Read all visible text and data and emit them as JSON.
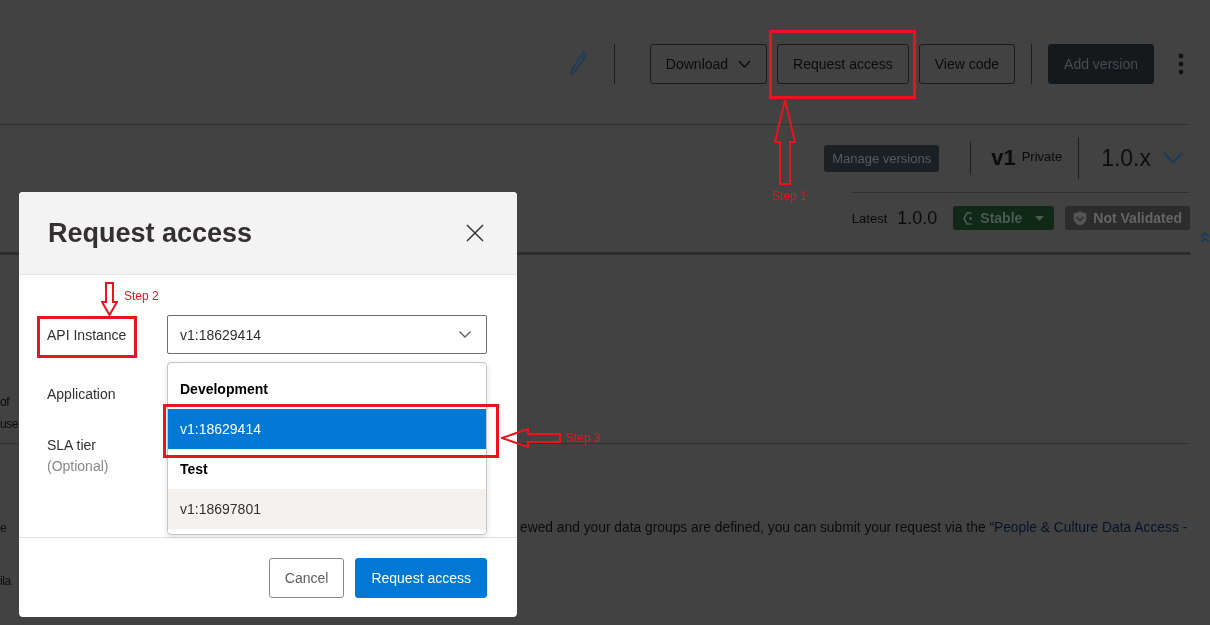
{
  "header": {
    "actions": [
      {
        "kind": "outline",
        "label": "Download",
        "menu": true
      },
      {
        "kind": "outline",
        "label": "Request access",
        "menu": false,
        "annotation": {
          "kind": "up_arrow",
          "label": "Step 1"
        }
      },
      {
        "kind": "outline",
        "label": "View code",
        "menu": false
      },
      {
        "kind": "primary",
        "label": "Add version",
        "menu": false
      }
    ]
  },
  "version_panel": {
    "manage_button": "Manage versions",
    "major_version": "v1",
    "visibility": "Private",
    "version_line": "1.0.x",
    "latest_label": "Latest",
    "latest_version": "1.0.0",
    "badges": [
      {
        "kind": "status",
        "label": "Stable",
        "menu": true
      },
      {
        "kind": "validation",
        "label": "Not Validated",
        "menu": false
      }
    ]
  },
  "content": {
    "paragraph_lines": [
      "of",
      "use"
    ],
    "sentence": {
      "left_fragment": "e",
      "text": "ewed and your data groups are defined, you can submit your request via the “",
      "link": "People & Culture Data Access -"
    },
    "trailing_fragment": "ila"
  },
  "dialog": {
    "title": "Request access",
    "fields": [
      {
        "kind": "select",
        "label": "API Instance",
        "value": "v1:18629414",
        "expanded": true,
        "annotation": {
          "kind": "down_arrow",
          "label": "Step 2"
        },
        "option_groups": [
          {
            "label": "Development",
            "options": [
              {
                "label": "v1:18629414",
                "selected": true,
                "hovered": false,
                "annotation": {
                  "kind": "left_arrow",
                  "label": "Step 3"
                }
              }
            ]
          },
          {
            "label": "Test",
            "options": [
              {
                "label": "v1:18697801",
                "selected": false,
                "hovered": true
              }
            ]
          }
        ]
      },
      {
        "kind": "label",
        "label": "Application"
      },
      {
        "kind": "label",
        "label": "SLA tier",
        "hint": "(Optional)"
      }
    ],
    "buttons": [
      {
        "kind": "secondary",
        "label": "Cancel"
      },
      {
        "kind": "primary",
        "label": "Request access"
      }
    ]
  }
}
